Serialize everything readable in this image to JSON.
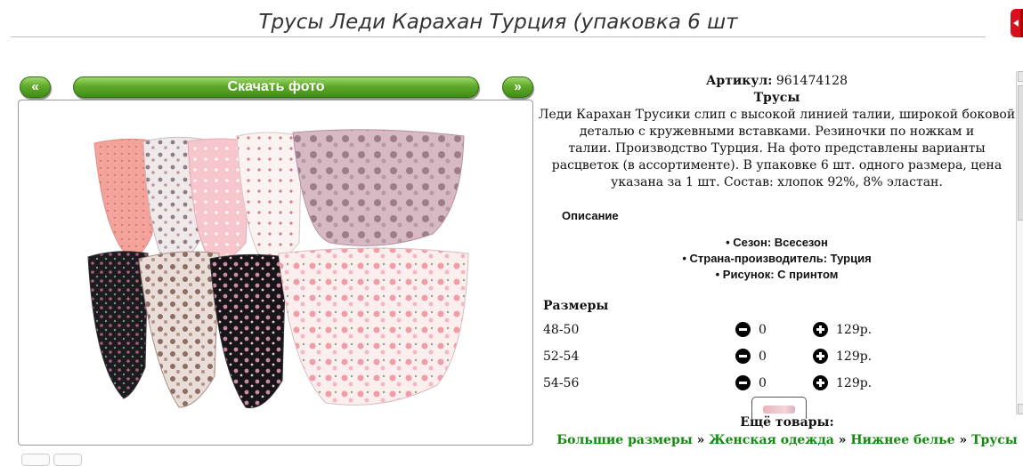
{
  "page": {
    "title": "Трусы Леди Карахан Турция (упаковка 6 шт"
  },
  "gallery": {
    "prev_label": "«",
    "download_label": "Скачать фото",
    "next_label": "»"
  },
  "product": {
    "sku_label": "Артикул:",
    "sku_value": "961474128",
    "type": "Трусы",
    "description_1": "Леди Карахан Трусики слип с высокой линией талии, широкой боковой деталью с кружевными вставками. Резиночки по ножкам и",
    "description_2": "талии. Производство Турция. На фото представлены варианты расцветок (в ассортименте). В упаковке 6 шт. одного размера, цена указана за 1 шт. Состав: хлопок 92%, 8% эластан.",
    "description_heading": "Описание",
    "properties": [
      "Сезон: Всесезон",
      "Страна-производитель: Турция",
      "Рисунок: С принтом"
    ]
  },
  "sizes": {
    "heading": "Размеры",
    "rows": [
      {
        "size": "48-50",
        "qty": "0",
        "price": "129р."
      },
      {
        "size": "52-54",
        "qty": "0",
        "price": "129р."
      },
      {
        "size": "54-56",
        "qty": "0",
        "price": "129р."
      }
    ]
  },
  "more": {
    "label": "Ещё товары:",
    "crumbs": [
      "Большие размеры",
      "Женская одежда",
      "Нижнее белье",
      "Трусы"
    ],
    "separator": "»"
  },
  "colors": {
    "button_green": "#5fa92a",
    "link_green": "#138a0f",
    "title_gray": "#333333"
  }
}
